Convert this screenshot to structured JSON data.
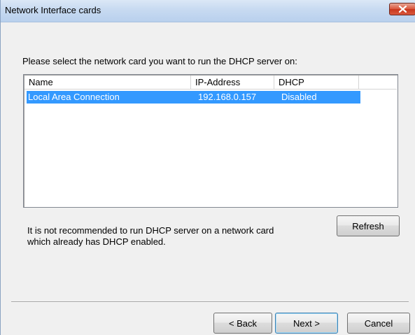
{
  "window": {
    "title": "Network Interface cards",
    "close_icon": "close-icon"
  },
  "prompt": "Please select the network card you want to run the DHCP server on:",
  "list": {
    "columns": [
      "Name",
      "IP-Address",
      "DHCP"
    ],
    "rows": [
      {
        "name": "Local Area Connection",
        "ip": "192.168.0.157",
        "dhcp": "Disabled",
        "selected": true
      }
    ]
  },
  "note": {
    "line1": "It is not recommended to run DHCP server on a network card",
    "line2": "which already has DHCP enabled."
  },
  "buttons": {
    "refresh": "Refresh",
    "back": "< Back",
    "next": "Next >",
    "cancel": "Cancel"
  },
  "colors": {
    "selection": "#3399ff",
    "close": "#c8371c"
  }
}
